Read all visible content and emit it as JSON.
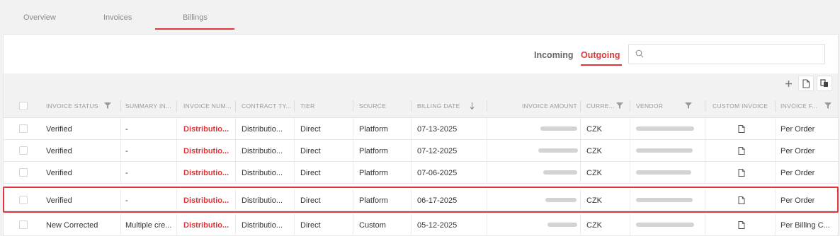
{
  "top_tabs": [
    "Overview",
    "Invoices",
    "Billings"
  ],
  "active_top_tab": "Billings",
  "direction": {
    "incoming": "Incoming",
    "outgoing": "Outgoing",
    "active": "Outgoing"
  },
  "search": {
    "value": "",
    "placeholder": ""
  },
  "toolbar": {
    "icons": [
      "plus-icon",
      "document-icon",
      "copy-icon"
    ]
  },
  "table": {
    "columns": [
      {
        "label": "INVOICE STATUS",
        "filter": true
      },
      {
        "label": "SUMMARY IN...",
        "filter": false
      },
      {
        "label": "INVOICE NUM...",
        "filter": false
      },
      {
        "label": "CONTRACT TY...",
        "filter": false
      },
      {
        "label": "TIER",
        "filter": false
      },
      {
        "label": "SOURCE",
        "filter": false
      },
      {
        "label": "BILLING DATE",
        "filter": false,
        "sort": "descending"
      },
      {
        "label": "INVOICE AMOUNT",
        "filter": false
      },
      {
        "label": "CURRE...",
        "filter": true
      },
      {
        "label": "VENDOR",
        "filter": true
      },
      {
        "label": "CUSTOM INVOICE",
        "filter": false
      },
      {
        "label": "INVOICE F...",
        "filter": true
      }
    ],
    "rows": [
      {
        "status": "Verified",
        "summary": "-",
        "invoice_number": "Distributio...",
        "contract_type": "Distributio...",
        "tier": "Direct",
        "source": "Platform",
        "billing_date": "07-13-2025",
        "currency": "CZK",
        "frequency": "Per Order"
      },
      {
        "status": "Verified",
        "summary": "-",
        "invoice_number": "Distributio...",
        "contract_type": "Distributio...",
        "tier": "Direct",
        "source": "Platform",
        "billing_date": "07-12-2025",
        "currency": "CZK",
        "frequency": "Per Order"
      },
      {
        "status": "Verified",
        "summary": "-",
        "invoice_number": "Distributio...",
        "contract_type": "Distributio...",
        "tier": "Direct",
        "source": "Platform",
        "billing_date": "07-06-2025",
        "currency": "CZK",
        "frequency": "Per Order"
      },
      {
        "status": "Verified",
        "summary": "-",
        "invoice_number": "Distributio...",
        "contract_type": "Distributio...",
        "tier": "Direct",
        "source": "Platform",
        "billing_date": "06-17-2025",
        "currency": "CZK",
        "frequency": "Per Order",
        "highlighted": true
      },
      {
        "status": "New Corrected",
        "summary": "Multiple cre...",
        "invoice_number": "Distributio...",
        "contract_type": "Distributio...",
        "tier": "Direct",
        "source": "Custom",
        "billing_date": "05-12-2025",
        "currency": "CZK",
        "frequency": "Per Billing C..."
      }
    ]
  },
  "colors": {
    "accent": "#e0353a",
    "header_bg": "#f2f2f2",
    "text": "#333333"
  }
}
